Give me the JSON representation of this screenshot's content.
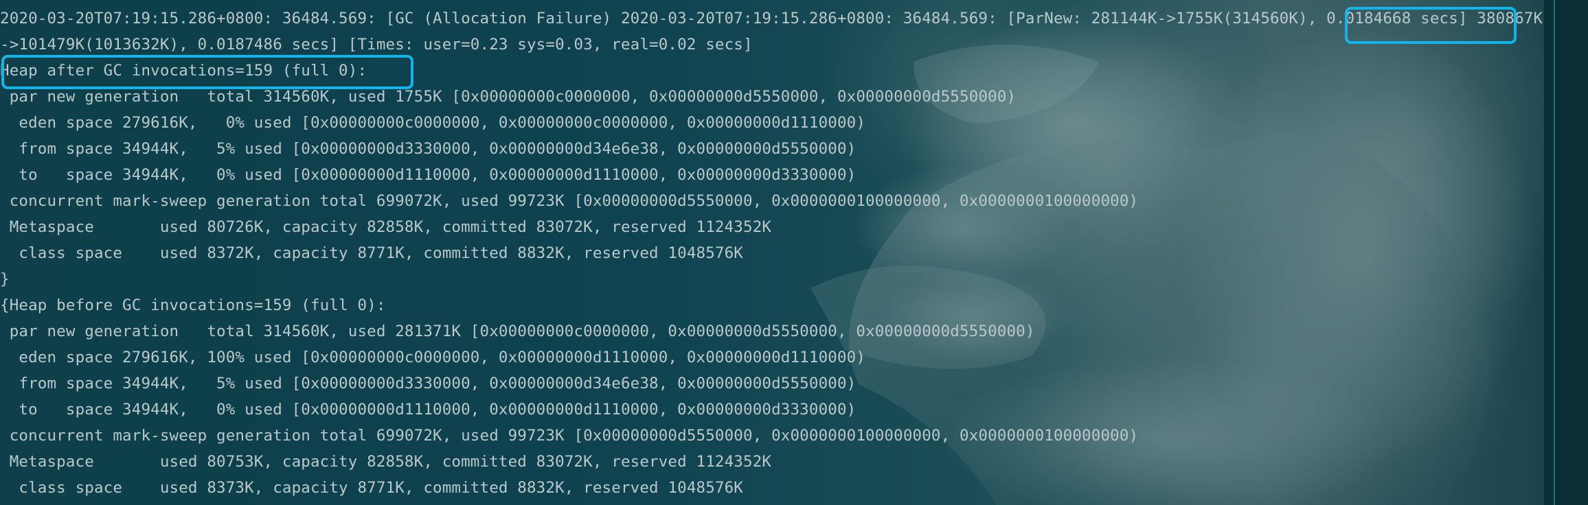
{
  "log_lines": [
    "2020-03-20T07:19:15.286+0800: 36484.569: [GC (Allocation Failure) 2020-03-20T07:19:15.286+0800: 36484.569: [ParNew: 281144K->1755K(314560K), 0.0184668 secs] 380867K",
    "->101479K(1013632K), 0.0187486 secs] [Times: user=0.23 sys=0.03, real=0.02 secs]",
    "Heap after GC invocations=159 (full 0):",
    " par new generation   total 314560K, used 1755K [0x00000000c0000000, 0x00000000d5550000, 0x00000000d5550000)",
    "  eden space 279616K,   0% used [0x00000000c0000000, 0x00000000c0000000, 0x00000000d1110000)",
    "  from space 34944K,   5% used [0x00000000d3330000, 0x00000000d34e6e38, 0x00000000d5550000)",
    "  to   space 34944K,   0% used [0x00000000d1110000, 0x00000000d1110000, 0x00000000d3330000)",
    " concurrent mark-sweep generation total 699072K, used 99723K [0x00000000d5550000, 0x0000000100000000, 0x0000000100000000)",
    " Metaspace       used 80726K, capacity 82858K, committed 83072K, reserved 1124352K",
    "  class space    used 8372K, capacity 8771K, committed 8832K, reserved 1048576K",
    "}",
    "{Heap before GC invocations=159 (full 0):",
    " par new generation   total 314560K, used 281371K [0x00000000c0000000, 0x00000000d5550000, 0x00000000d5550000)",
    "  eden space 279616K, 100% used [0x00000000c0000000, 0x00000000d1110000, 0x00000000d1110000)",
    "  from space 34944K,   5% used [0x00000000d3330000, 0x00000000d34e6e38, 0x00000000d5550000)",
    "  to   space 34944K,   0% used [0x00000000d1110000, 0x00000000d1110000, 0x00000000d3330000)",
    " concurrent mark-sweep generation total 699072K, used 99723K [0x00000000d5550000, 0x0000000100000000, 0x0000000100000000)",
    " Metaspace       used 80753K, capacity 82858K, committed 83072K, reserved 1124352K",
    "  class space    used 8373K, capacity 8771K, committed 8832K, reserved 1048576K"
  ],
  "highlights": {
    "gc_time": "0.0184668 secs",
    "heap_after_gc": "Heap after GC invocations=159 (full 0):"
  },
  "colors": {
    "text": "#b9c9cb",
    "background": "#0b3a45",
    "highlight_border": "#14b4e8"
  }
}
